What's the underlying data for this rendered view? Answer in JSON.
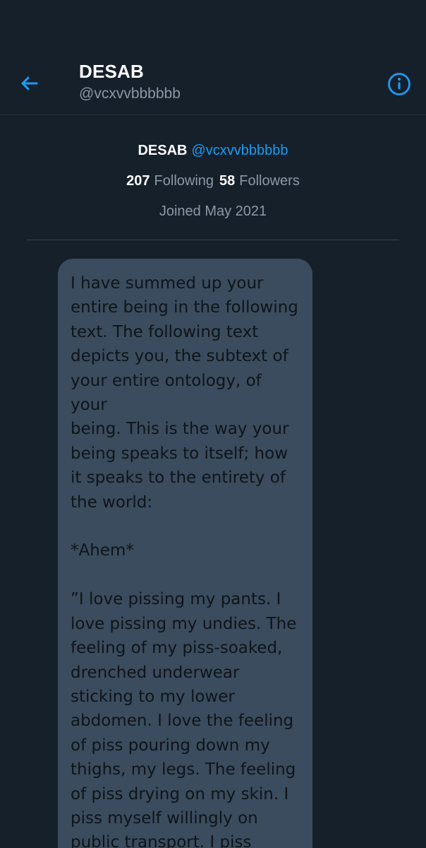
{
  "header": {
    "display_name": "DESAB",
    "handle": "@vcxvvbbbbbb",
    "back_icon": "arrow-left-icon",
    "info_icon": "info-circle-icon"
  },
  "profile_summary": {
    "display_name": "DESAB",
    "handle": "@vcxvvbbbbbb",
    "following_count": "207",
    "following_label": "Following",
    "followers_count": "58",
    "followers_label": "Followers",
    "joined": "Joined May 2021"
  },
  "message": {
    "text": "I have summed up your\nentire being in the following\ntext. The following text\ndepicts you, the subtext of\nyour entire ontology, of your\nbeing. This is the way your\nbeing speaks to itself; how\nit speaks to the entirety of\nthe world:\n\n*Ahem*\n\n”I love pissing my pants. I\nlove pissing my undies. The\nfeeling of my piss-soaked,\ndrenched underwear\nsticking to my lower\nabdomen. I love the feeling\nof piss pouring down my\nthighs, my legs. The feeling\nof piss drying on my skin. I\npiss myself willingly on\npublic transport. I piss\nmyself on the bus, my"
  },
  "colors": {
    "background": "#15202b",
    "accent": "#1d9bf0",
    "secondary_text": "#8b98a5",
    "bubble": "#3a4c5e"
  }
}
